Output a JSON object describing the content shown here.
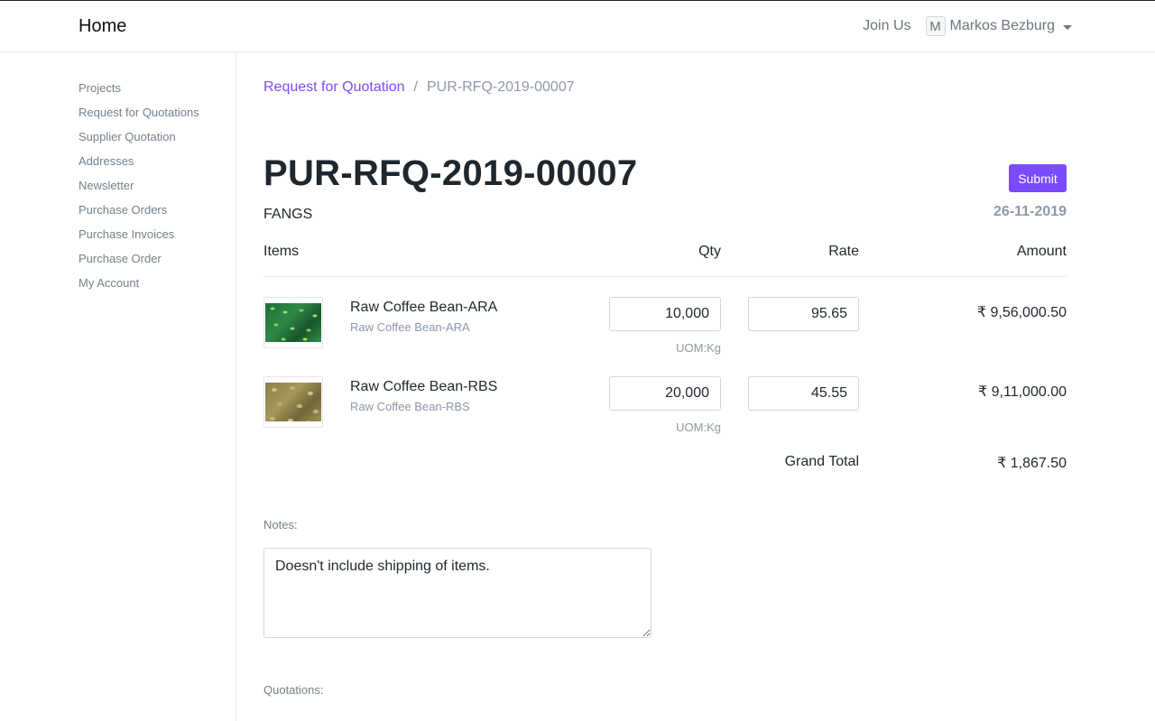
{
  "navbar": {
    "brand": "Home",
    "join_us": "Join Us",
    "user": {
      "avatar_letter": "M",
      "name": "Markos Bezburg"
    }
  },
  "sidebar": {
    "items": [
      {
        "label": "Projects"
      },
      {
        "label": "Request for Quotations"
      },
      {
        "label": "Supplier Quotation"
      },
      {
        "label": "Addresses"
      },
      {
        "label": "Newsletter"
      },
      {
        "label": "Purchase Orders"
      },
      {
        "label": "Purchase Invoices"
      },
      {
        "label": "Purchase Order"
      },
      {
        "label": "My Account"
      }
    ]
  },
  "breadcrumb": {
    "parent": "Request for Quotation",
    "separator": "/",
    "current": "PUR-RFQ-2019-00007"
  },
  "document": {
    "title": "PUR-RFQ-2019-00007",
    "supplier": "FANGS",
    "date": "26-11-2019",
    "submit_label": "Submit"
  },
  "items_table": {
    "headers": {
      "items": "Items",
      "qty": "Qty",
      "rate": "Rate",
      "amount": "Amount"
    },
    "rows": [
      {
        "name": "Raw Coffee Bean-ARA",
        "code": "Raw Coffee Bean-ARA",
        "image": "green-coffee-beans",
        "qty": "10,000",
        "uom": "UOM:Kg",
        "rate": "95.65",
        "amount": "₹ 9,56,000.50"
      },
      {
        "name": "Raw Coffee Bean-RBS",
        "code": "Raw Coffee Bean-RBS",
        "image": "yellow-coffee-beans",
        "qty": "20,000",
        "uom": "UOM:Kg",
        "rate": "45.55",
        "amount": "₹ 9,11,000.00"
      }
    ],
    "grand_total_label": "Grand Total",
    "grand_total_value": "₹ 1,867.50"
  },
  "notes": {
    "label": "Notes:",
    "value": "Doesn't include shipping of items."
  },
  "quotations": {
    "label": "Quotations:"
  },
  "colors": {
    "accent": "#7b4bff",
    "text_dark": "#1f272e",
    "text_muted": "#8d99a6",
    "border": "#d1d8dd"
  }
}
